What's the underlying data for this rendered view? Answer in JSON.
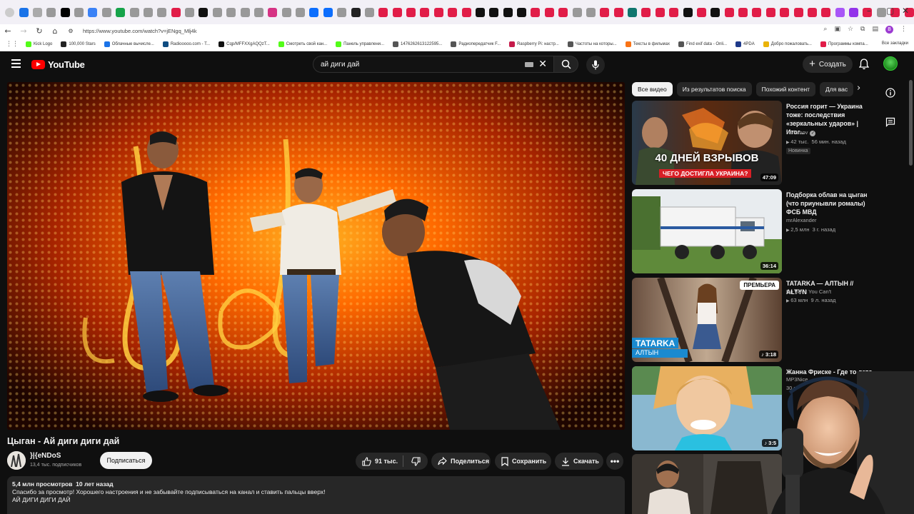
{
  "browser": {
    "active_tab_close": "×",
    "new_tab": "+",
    "url": "https://www.youtube.com/watch?v=jENgq_Mlj4k",
    "profile_initial": "B",
    "tab_colors": [
      "#1a73e8",
      "#aaa",
      "#999",
      "#000",
      "#999",
      "#3b82f6",
      "#999",
      "#16a34a",
      "#999",
      "#999",
      "#999",
      "#e11d48",
      "#999",
      "#111",
      "#999",
      "#999",
      "#999",
      "#999",
      "#d63384",
      "#999",
      "#999",
      "#0d6efd",
      "#0d6efd",
      "#999",
      "#222",
      "#999",
      "#e11d48",
      "#e11d48",
      "#e11d48",
      "#e11d48",
      "#e11d48",
      "#e11d48",
      "#e11d48",
      "#111",
      "#111",
      "#111",
      "#111",
      "#e11d48",
      "#e11d48",
      "#e11d48",
      "#999",
      "#999",
      "#e11d48",
      "#e11d48",
      "#0f766e",
      "#e11d48",
      "#e11d48",
      "#e11d48",
      "#111",
      "#e11d48",
      "#111",
      "#e11d48",
      "#e11d48",
      "#e11d48",
      "#e11d48",
      "#e11d48",
      "#e11d48",
      "#e11d48",
      "#e11d48",
      "#a855f7",
      "#9333ea",
      "#e11d48",
      "#999",
      "#e11d48",
      "#e11d48",
      "#e11d48",
      "#e11d48",
      "#e11d48",
      "#e11d48",
      "#0ea5e9",
      "#1a73e8",
      "#e11d48",
      "#e11d48",
      "#e11d48",
      "#999",
      "#e11d48",
      "#e11d48",
      "#e11d48",
      "#e11d48",
      "#e11d48",
      "#e11d48",
      "#e11d48"
    ],
    "bookmarks": [
      {
        "label": "Kick Logo",
        "color": "#53fc18"
      },
      {
        "label": "100,000 Stars",
        "color": "#222"
      },
      {
        "label": "Облачные вычисле...",
        "color": "#1a73e8"
      },
      {
        "label": "Radiooooo.com - T...",
        "color": "#0f4c81"
      },
      {
        "label": "Cqp/MFFXXgAQQzT...",
        "color": "#111"
      },
      {
        "label": "Смотреть свой кан...",
        "color": "#53fc18"
      },
      {
        "label": "Панель управлени...",
        "color": "#53fc18"
      },
      {
        "label": "1476262613122595...",
        "color": "#555"
      },
      {
        "label": "Радиопередатчик F...",
        "color": "#555"
      },
      {
        "label": "Raspberry Pi: настр...",
        "color": "#c51a4a"
      },
      {
        "label": "Частоты на которы...",
        "color": "#555"
      },
      {
        "label": "Тексты в фильмах",
        "color": "#f97316"
      },
      {
        "label": "Find exif data - Onli...",
        "color": "#555"
      },
      {
        "label": "4PDA",
        "color": "#1e3a8a"
      },
      {
        "label": "Добро пожаловать...",
        "color": "#eab308"
      },
      {
        "label": "Программы компа...",
        "color": "#e11d48"
      }
    ],
    "all_bookmarks": "Все закладки"
  },
  "header": {
    "logo_text": "YouTube",
    "search_value": "ай диги дай",
    "create_label": "Создать"
  },
  "video": {
    "title": "Цыган - Ай диги диги дай",
    "channel_name": "}|{eNDoS",
    "subscribers": "13,4 тыс. подписчиков",
    "subscribe_label": "Подписаться",
    "likes": "91 тыс.",
    "share_label": "Поделиться",
    "save_label": "Сохранить",
    "download_label": "Скачать",
    "more_label": "•••",
    "description_meta": "5,4 млн просмотров  10 лет назад",
    "description_text": "Спасибо за просмотр! Хорошего настроения и не забывайте подписываться на канал и ставить пальцы вверх!",
    "description_text2": "АЙ ДИГИ ДИГИ ДАЙ"
  },
  "chips": [
    "Все видео",
    "Из результатов поиска",
    "Похожий контент",
    "Для вас"
  ],
  "recommendations": [
    {
      "title": "Россия горит — Украина тоже: последствия «зеркальных ударов» | Итог...",
      "channel": "varlamov",
      "verified": true,
      "meta": "42 тыс.  56 мин. назад",
      "badge": "Новинка",
      "duration": "47:09",
      "thumb_text": "40 ДНЕЙ ВЗРЫВОВ",
      "thumb_subtext": "ЧЕГО ДОСТИГЛА УКРАИНА?"
    },
    {
      "title": "Подборка облав на цыган (что приунывли ромалы) ФСБ МВД",
      "channel": "mrAlexander",
      "meta": "2,5 млн  3 г. назад",
      "duration": "36:14"
    },
    {
      "title": "TATARKA — АЛТЫН // ALTYN",
      "channel": "Do What You Can't",
      "meta": "63 млн  9 л. назад",
      "duration": "3:18",
      "premiere": "ПРЕМЬЕРА",
      "thumb_text": "TATARKA",
      "thumb_subtext": "АЛТЫН"
    },
    {
      "title": "Жанна Фриске - Где то лето",
      "channel": "MP3Nice",
      "meta": "30 м",
      "duration": "3:5"
    }
  ]
}
